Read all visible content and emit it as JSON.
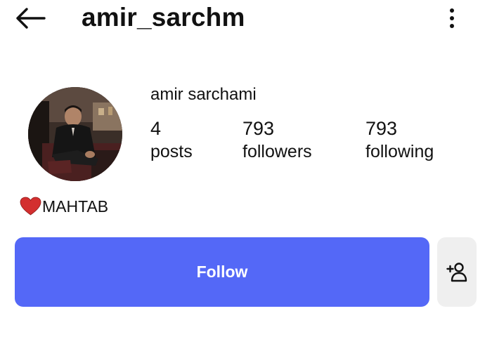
{
  "header": {
    "username": "amir_sarchm",
    "back_icon": "arrow-left-icon",
    "more_icon": "more-vertical-icon"
  },
  "profile": {
    "display_name": "amir sarchami",
    "stats": [
      {
        "count": "4",
        "label": "posts"
      },
      {
        "count": "793",
        "label": "followers"
      },
      {
        "count": "793",
        "label": "following"
      }
    ],
    "bio": {
      "emoji": "heart-icon",
      "text": "MAHTAB"
    }
  },
  "actions": {
    "follow_label": "Follow",
    "add_user_icon": "add-user-icon"
  },
  "colors": {
    "follow_button": "#5468f7",
    "secondary_button": "#efefef",
    "heart": "#d32f2f"
  }
}
